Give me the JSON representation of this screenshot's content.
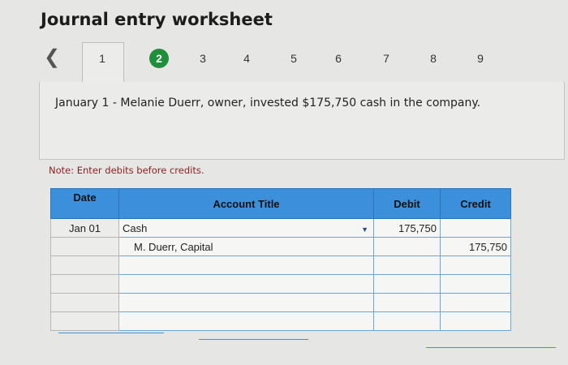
{
  "title": "Journal entry worksheet",
  "nav": {
    "prev_icon": "chevron-left-icon",
    "tabs": [
      "1",
      "2",
      "3",
      "4",
      "5",
      "6",
      "7",
      "8",
      "9"
    ],
    "active_tab": "2"
  },
  "prompt": "January 1 - Melanie Duerr, owner, invested $175,750 cash in the company.",
  "note": "Note: Enter debits before credits.",
  "table": {
    "headers": {
      "date": "Date",
      "account": "Account Title",
      "debit": "Debit",
      "credit": "Credit"
    },
    "rows": [
      {
        "date": "Jan 01",
        "account": "Cash",
        "debit": "175,750",
        "credit": ""
      },
      {
        "date": "",
        "account": "M. Duerr, Capital",
        "debit": "",
        "credit": "175,750"
      },
      {
        "date": "",
        "account": "",
        "debit": "",
        "credit": ""
      },
      {
        "date": "",
        "account": "",
        "debit": "",
        "credit": ""
      },
      {
        "date": "",
        "account": "",
        "debit": "",
        "credit": ""
      },
      {
        "date": "",
        "account": "",
        "debit": "",
        "credit": ""
      }
    ]
  },
  "colors": {
    "accent": "#3b8fdb",
    "active_tab": "#1f8f3a",
    "note": "#8a1f1f"
  }
}
